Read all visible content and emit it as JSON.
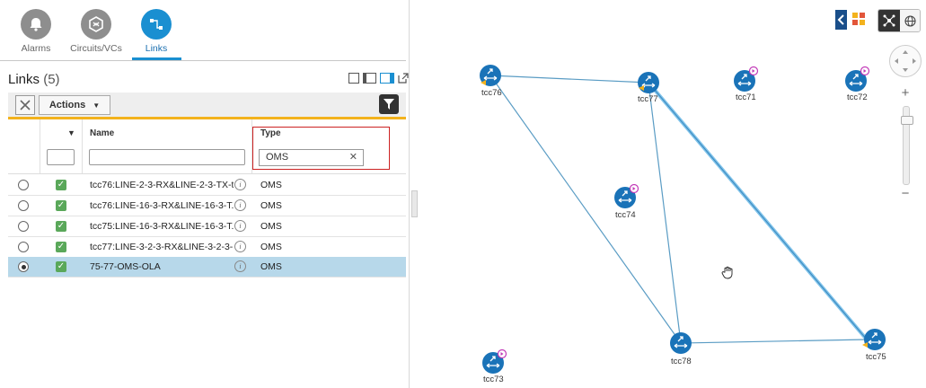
{
  "tabs": [
    {
      "label": "Alarms",
      "icon": "bell-icon"
    },
    {
      "label": "Circuits/VCs",
      "icon": "circuits-icon"
    },
    {
      "label": "Links",
      "icon": "links-icon"
    }
  ],
  "links_panel": {
    "title": "Links",
    "count": "(5)",
    "actions_label": "Actions",
    "columns": {
      "name": "Name",
      "type": "Type"
    },
    "type_filter_value": "OMS",
    "rows": [
      {
        "name": "tcc76:LINE-2-3-RX&LINE-2-3-TX-t...",
        "type": "OMS",
        "selected": false
      },
      {
        "name": "tcc76:LINE-16-3-RX&LINE-16-3-T...",
        "type": "OMS",
        "selected": false
      },
      {
        "name": "tcc75:LINE-16-3-RX&LINE-16-3-T...",
        "type": "OMS",
        "selected": false
      },
      {
        "name": "tcc77:LINE-3-2-3-RX&LINE-3-2-3-...",
        "type": "OMS",
        "selected": false
      },
      {
        "name": "75-77-OMS-OLA",
        "type": "OMS",
        "selected": true
      }
    ]
  },
  "map": {
    "nodes": [
      "tcc76",
      "tcc77",
      "tcc71",
      "tcc72",
      "tcc74",
      "tcc78",
      "tcc75",
      "tcc73"
    ],
    "zoom_in": "+",
    "zoom_out": "−"
  },
  "colors": {
    "accent": "#1a8fd1",
    "toolbar_bar": "#f3b21d",
    "selected_row": "#b7d8ea",
    "link_line": "#5a9cc4",
    "highlight_link": "#7fc3ea"
  }
}
